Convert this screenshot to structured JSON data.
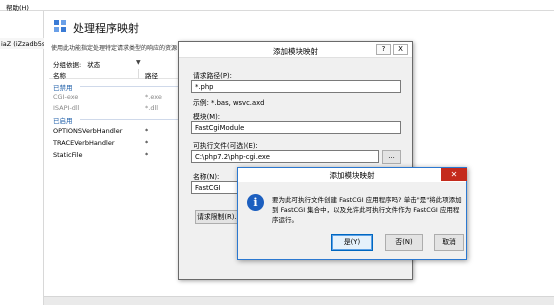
{
  "menubar": {
    "help": "帮助(H)"
  },
  "tree": {
    "selected_node": "iaZ (iZzadb5s"
  },
  "main": {
    "title": "处理程序映射",
    "description": "使用此功能指定处理特定请求类型的响应的资源",
    "group_by_label": "分组依据:",
    "group_by_value": "状态",
    "columns": {
      "name": "名称",
      "path": "路径"
    },
    "groups": {
      "disabled": "已禁用",
      "enabled": "已启用"
    },
    "disabled_rows": [
      {
        "name": "CGI-exe",
        "path": "*.exe"
      },
      {
        "name": "ISAPI-dll",
        "path": "*.dll"
      }
    ],
    "enabled_rows": [
      {
        "name": "OPTIONSVerbHandler",
        "path": "*"
      },
      {
        "name": "TRACEVerbHandler",
        "path": "*"
      },
      {
        "name": "StaticFile",
        "path": "*"
      }
    ]
  },
  "add_module_dialog": {
    "title": "添加模块映射",
    "help_button": "?",
    "close_button": "X",
    "request_path_label": "请求路径(P):",
    "request_path_value": "*.php",
    "example": "示例: *.bas, wsvc.axd",
    "module_label": "模块(M):",
    "module_value": "FastCgiModule",
    "executable_label": "可执行文件(可选)(E):",
    "executable_value": "C:\\php7.2\\php-cgi.exe",
    "browse_button": "...",
    "name_label": "名称(N):",
    "name_value": "FastCGI",
    "request_restrictions_button": "请求限制(R)..."
  },
  "confirm_dialog": {
    "title": "添加模块映射",
    "close_button": "✕",
    "message": "要为此可执行文件创建 FastCGI 应用程序吗? 单击\"是\"将此项添加到 FastCGI 集合中，以及允许此可执行文件作为 FastCGI 应用程序运行。",
    "yes_button": "是(Y)",
    "no_button": "否(N)",
    "cancel_button": "取消"
  },
  "colors": {
    "accent": "#0067c0",
    "group_header": "#1f5fa9",
    "close_red": "#c42b1c"
  }
}
